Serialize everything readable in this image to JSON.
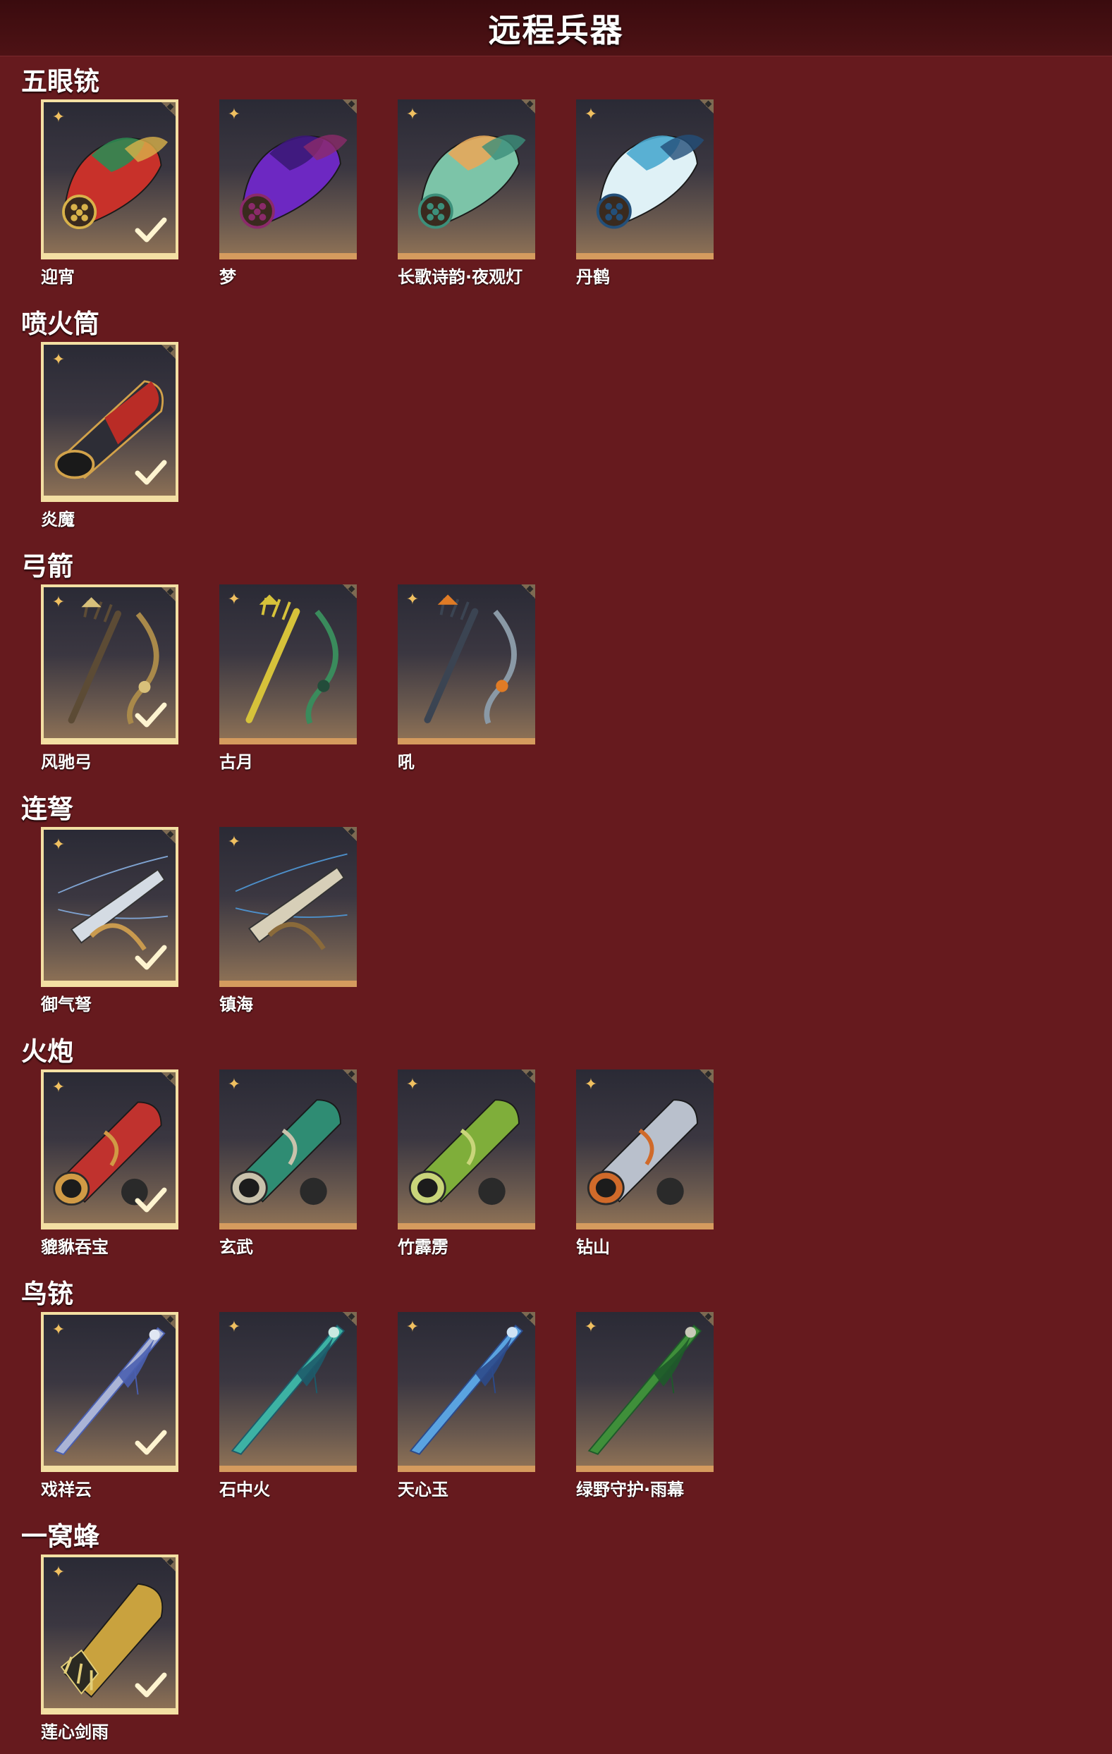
{
  "header": {
    "title": "远程兵器"
  },
  "categories": [
    {
      "title": "五眼铳",
      "items": [
        {
          "name": "迎宵",
          "owned": true,
          "art": "gatling-red-dragon",
          "palette": [
            "#c8312a",
            "#2d8a52",
            "#d9b24a"
          ]
        },
        {
          "name": "梦",
          "owned": false,
          "art": "gatling-purple-beast",
          "palette": [
            "#6d28c2",
            "#3b1878",
            "#8b2a6a"
          ]
        },
        {
          "name": "长歌诗韵·夜观灯",
          "owned": false,
          "art": "gatling-jade-koi",
          "palette": [
            "#7cc4a8",
            "#e7a95a",
            "#3c8f7a"
          ]
        },
        {
          "name": "丹鹤",
          "owned": false,
          "art": "gatling-crane",
          "palette": [
            "#dff1f6",
            "#4aa8cf",
            "#234f79"
          ]
        }
      ]
    },
    {
      "title": "喷火筒",
      "items": [
        {
          "name": "炎魔",
          "owned": true,
          "art": "flamethrower",
          "palette": [
            "#b92c26",
            "#2b2b34",
            "#d2a24a"
          ]
        }
      ]
    },
    {
      "title": "弓箭",
      "items": [
        {
          "name": "风驰弓",
          "owned": true,
          "art": "bow-gold",
          "palette": [
            "#a9894a",
            "#5c4b35",
            "#d8c07a"
          ]
        },
        {
          "name": "古月",
          "owned": false,
          "art": "bow-green",
          "palette": [
            "#3a8b5c",
            "#d6c23a",
            "#234c3a"
          ]
        },
        {
          "name": "吼",
          "owned": false,
          "art": "bow-silver",
          "palette": [
            "#8a99a6",
            "#3b4452",
            "#e07b25"
          ]
        }
      ]
    },
    {
      "title": "连弩",
      "items": [
        {
          "name": "御气弩",
          "owned": true,
          "art": "crossbow-silver",
          "palette": [
            "#d4dbe3",
            "#7fa3d1",
            "#c99a4e"
          ]
        },
        {
          "name": "镇海",
          "owned": false,
          "art": "crossbow-sea",
          "palette": [
            "#d7cfb8",
            "#4d8fc9",
            "#8a6a3a"
          ]
        }
      ]
    },
    {
      "title": "火炮",
      "items": [
        {
          "name": "貔貅吞宝",
          "owned": true,
          "art": "cannon-red",
          "palette": [
            "#c0322e",
            "#d19a45",
            "#2a2a2a"
          ]
        },
        {
          "name": "玄武",
          "owned": false,
          "art": "cannon-turtle",
          "palette": [
            "#2f8c73",
            "#c9c2ac",
            "#2a2a2a"
          ]
        },
        {
          "name": "竹霹雳",
          "owned": false,
          "art": "cannon-bamboo",
          "palette": [
            "#7fae3a",
            "#c9d57a",
            "#2a2a2a"
          ]
        },
        {
          "name": "钻山",
          "owned": false,
          "art": "cannon-drill",
          "palette": [
            "#b9c0cc",
            "#d06a2a",
            "#2a2a2a"
          ]
        }
      ]
    },
    {
      "title": "鸟铳",
      "items": [
        {
          "name": "戏祥云",
          "owned": true,
          "art": "musket-cloud",
          "palette": [
            "#aab4d6",
            "#4a5fb0",
            "#e0e6f2"
          ]
        },
        {
          "name": "石中火",
          "owned": false,
          "art": "musket-teal",
          "palette": [
            "#3db2a4",
            "#1d5b6a",
            "#c9e8e0"
          ]
        },
        {
          "name": "天心玉",
          "owned": false,
          "art": "musket-blue",
          "palette": [
            "#5aa3e0",
            "#2c4a8a",
            "#cfe3f5"
          ]
        },
        {
          "name": "绿野守护·雨幕",
          "owned": false,
          "art": "musket-green",
          "palette": [
            "#3f8f3a",
            "#1e5a2a",
            "#c9c9b8"
          ]
        }
      ]
    },
    {
      "title": "一窝蜂",
      "items": [
        {
          "name": "莲心剑雨",
          "owned": true,
          "art": "rocket-lotus",
          "palette": [
            "#c9a23e",
            "#2b2a22",
            "#e3cf7a"
          ]
        }
      ]
    }
  ]
}
